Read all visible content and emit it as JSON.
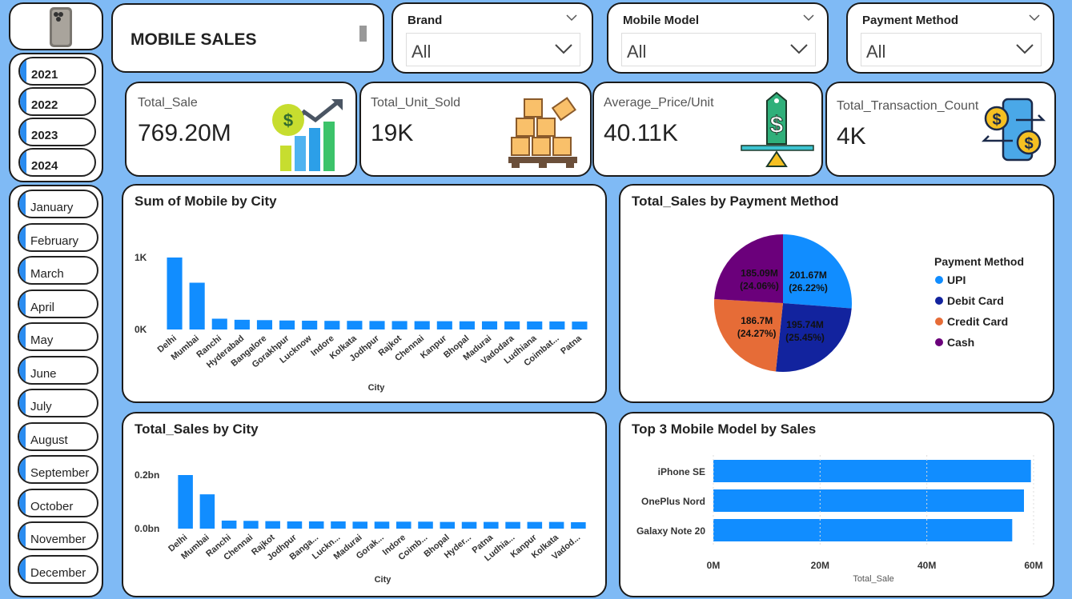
{
  "header": {
    "title": "MOBILE SALES"
  },
  "filters": [
    {
      "label": "Brand",
      "value": "All"
    },
    {
      "label": "Mobile Model",
      "value": "All"
    },
    {
      "label": "Payment Method",
      "value": "All"
    }
  ],
  "years": [
    "2021",
    "2022",
    "2023",
    "2024"
  ],
  "months": [
    "January",
    "February",
    "March",
    "April",
    "May",
    "June",
    "July",
    "August",
    "September",
    "October",
    "November",
    "December"
  ],
  "kpis": [
    {
      "label": "Total_Sale",
      "value": "769.20M"
    },
    {
      "label": "Total_Unit_Sold",
      "value": "19K"
    },
    {
      "label": "Average_Price/Unit",
      "value": "40.11K"
    },
    {
      "label": "Total_Transaction_Count",
      "value": "4K"
    }
  ],
  "colors": {
    "accent": "#2a8cf0",
    "upi": "#118DFF",
    "debit": "#12239E",
    "credit": "#E66C37",
    "cash": "#6B007B"
  },
  "chart_data": [
    {
      "type": "bar",
      "title": "Sum of Mobile by City",
      "xlabel": "City",
      "ylabel": "",
      "ytick_labels": [
        "1K",
        "0K"
      ],
      "ylim": [
        0,
        1000
      ],
      "categories": [
        "Delhi",
        "Mumbai",
        "Ranchi",
        "Hyderabad",
        "Bangalore",
        "Gorakhpur",
        "Lucknow",
        "Indore",
        "Kolkata",
        "Jodhpur",
        "Rajkot",
        "Chennai",
        "Kanpur",
        "Bhopal",
        "Madurai",
        "Vadodara",
        "Ludhiana",
        "Coimbat...",
        "Patna"
      ],
      "values": [
        1000,
        650,
        150,
        135,
        130,
        125,
        122,
        120,
        120,
        118,
        117,
        116,
        115,
        114,
        114,
        113,
        112,
        112,
        110
      ]
    },
    {
      "type": "pie",
      "title": "Total_Sales by Payment Method",
      "legend_title": "Payment Method",
      "series": [
        {
          "name": "UPI",
          "value": 201.67,
          "label": "201.67M",
          "pct": "(26.22%)"
        },
        {
          "name": "Debit Card",
          "value": 195.74,
          "label": "195.74M",
          "pct": "(25.45%)"
        },
        {
          "name": "Credit Card",
          "value": 186.7,
          "label": "186.7M",
          "pct": "(24.27%)"
        },
        {
          "name": "Cash",
          "value": 185.09,
          "label": "185.09M",
          "pct": "(24.06%)"
        }
      ]
    },
    {
      "type": "bar",
      "title": "Total_Sales by City",
      "xlabel": "City",
      "ylabel": "",
      "ytick_labels": [
        "0.2bn",
        "0.0bn"
      ],
      "ylim": [
        0,
        0.2
      ],
      "categories": [
        "Delhi",
        "Mumbai",
        "Ranchi",
        "Chennai",
        "Rajkot",
        "Jodhpur",
        "Banga...",
        "Luckn...",
        "Madurai",
        "Gorak...",
        "Indore",
        "Coimb...",
        "Bhopal",
        "Hyder...",
        "Patna",
        "Ludhia...",
        "Kanpur",
        "Kolkata",
        "Vadod..."
      ],
      "values": [
        0.2,
        0.128,
        0.03,
        0.029,
        0.028,
        0.027,
        0.027,
        0.027,
        0.026,
        0.026,
        0.026,
        0.026,
        0.025,
        0.025,
        0.025,
        0.025,
        0.025,
        0.025,
        0.024
      ]
    },
    {
      "type": "bar",
      "orientation": "horizontal",
      "title": "Top 3 Mobile Model by Sales",
      "xlabel": "Total_Sale",
      "ylabel": "",
      "xtick_labels": [
        "0M",
        "20M",
        "40M",
        "60M"
      ],
      "xlim": [
        0,
        60
      ],
      "categories": [
        "iPhone SE",
        "OnePlus Nord",
        "Galaxy Note 20"
      ],
      "values": [
        59.5,
        58.2,
        56.0
      ]
    }
  ]
}
